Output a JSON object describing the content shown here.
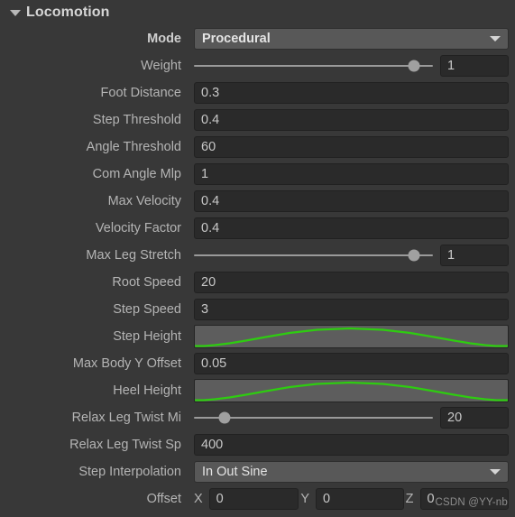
{
  "header": {
    "title": "Locomotion",
    "foldout_state": "expanded"
  },
  "colors": {
    "panel_background": "#383838",
    "field_background": "#2a2a2a",
    "dropdown_background": "#585858",
    "curve_background": "#5d5d5d",
    "curve_line": "#2ecc10",
    "label_text": "#b4b4b4",
    "value_text": "#c8c8c8",
    "slider_track": "#9a9a9a",
    "slider_handle": "#a0a0a0"
  },
  "rows": [
    {
      "label": "Mode",
      "type": "dropdown",
      "value": "Procedural"
    },
    {
      "label": "Weight",
      "type": "slider",
      "value": "1",
      "fill": 92
    },
    {
      "label": "Foot Distance",
      "type": "text",
      "value": "0.3"
    },
    {
      "label": "Step Threshold",
      "type": "text",
      "value": "0.4"
    },
    {
      "label": "Angle Threshold",
      "type": "text",
      "value": "60"
    },
    {
      "label": "Com Angle Mlp",
      "type": "text",
      "value": "1"
    },
    {
      "label": "Max Velocity",
      "type": "text",
      "value": "0.4"
    },
    {
      "label": "Velocity Factor",
      "type": "text",
      "value": "0.4"
    },
    {
      "label": "Max Leg Stretch",
      "type": "slider",
      "value": "1",
      "fill": 92
    },
    {
      "label": "Root Speed",
      "type": "text",
      "value": "20"
    },
    {
      "label": "Step Speed",
      "type": "text",
      "value": "3"
    },
    {
      "label": "Step Height",
      "type": "curve",
      "value": ""
    },
    {
      "label": "Max Body Y Offset",
      "type": "text",
      "value": "0.05"
    },
    {
      "label": "Heel Height",
      "type": "curve",
      "value": ""
    },
    {
      "label": "Relax Leg Twist Mi",
      "type": "slider",
      "value": "20",
      "fill": 13
    },
    {
      "label": "Relax Leg Twist Sp",
      "type": "text",
      "value": "400"
    },
    {
      "label": "Step Interpolation",
      "type": "dropdown",
      "value": "In Out Sine"
    }
  ],
  "offset_row": {
    "label": "Offset",
    "axes": [
      {
        "axis": "X",
        "value": "0"
      },
      {
        "axis": "Y",
        "value": "0"
      },
      {
        "axis": "Z",
        "value": "0"
      }
    ]
  },
  "watermark": {
    "text": "CSDN @YY-nb"
  },
  "icons": {
    "foldout": "triangle-down-icon",
    "dropdown": "chevron-down-icon"
  }
}
